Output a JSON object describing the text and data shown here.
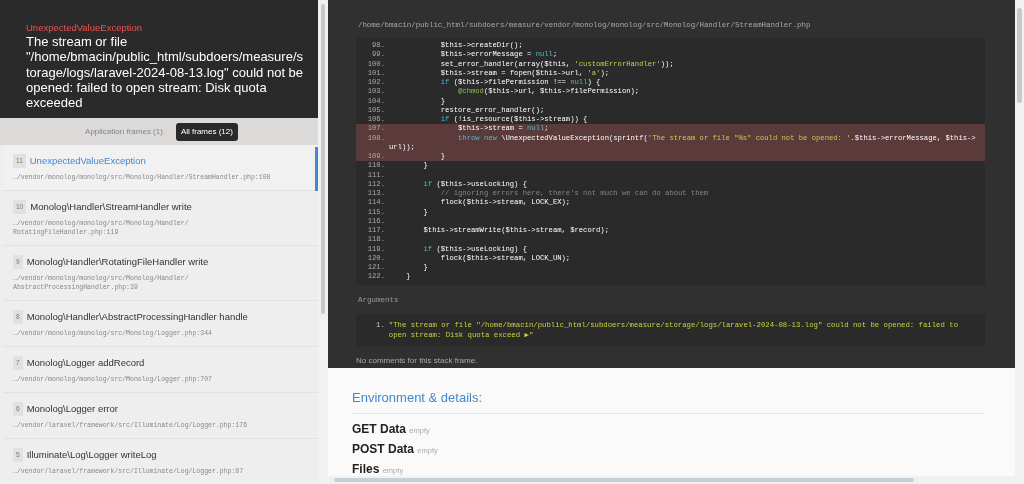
{
  "header": {
    "exception_class": "UnexpectedValueException",
    "message": "The stream or file \"/home/bmacin/public_html/subdoers/measure/storage/logs/laravel-2024-08-13.log\" could not be opened: failed to open stream: Disk quota exceeded"
  },
  "frame_tabs": [
    {
      "label": "Application frames (1)",
      "selected": false
    },
    {
      "label": "All frames (12)",
      "selected": true
    }
  ],
  "frames": [
    {
      "number": "11",
      "title": "UnexpectedValueException",
      "path": "…/vendor/monolog/monolog/src/Monolog/Handler/StreamHandler.php:108",
      "selected": true
    },
    {
      "number": "10",
      "title": "Monolog\\Handler\\StreamHandler write",
      "path": "…/vendor/monolog/monolog/src/Monolog/Handler/\nRotatingFileHandler.php:119",
      "selected": false
    },
    {
      "number": "9",
      "title": "Monolog\\Handler\\RotatingFileHandler write",
      "path": "…/vendor/monolog/monolog/src/Monolog/Handler/\nAbstractProcessingHandler.php:39",
      "selected": false
    },
    {
      "number": "8",
      "title": "Monolog\\Handler\\AbstractProcessingHandler handle",
      "path": "…/vendor/monolog/monolog/src/Monolog/Logger.php:344",
      "selected": false
    },
    {
      "number": "7",
      "title": "Monolog\\Logger addRecord",
      "path": "…/vendor/monolog/monolog/src/Monolog/Logger.php:707",
      "selected": false
    },
    {
      "number": "6",
      "title": "Monolog\\Logger error",
      "path": "…/vendor/laravel/framework/src/Illuminate/Log/Logger.php:176",
      "selected": false
    },
    {
      "number": "5",
      "title": "Illuminate\\Log\\Logger writeLog",
      "path": "…/vendor/laravel/framework/src/Illuminate/Log/Logger.php:87",
      "selected": false
    }
  ],
  "code": {
    "file_path": "/home/bmacin/public_html/subdoers/measure/vendor/monolog/monolog/src/Monolog/Handler/StreamHandler.php",
    "lines": [
      {
        "number": "98.",
        "highlighted": false,
        "tokens": [
          {
            "text": "            $this->createDir();",
            "kind": "plain"
          }
        ]
      },
      {
        "number": "99.",
        "highlighted": false,
        "tokens": [
          {
            "text": "            $this->errorMessage = ",
            "kind": "plain"
          },
          {
            "text": "null",
            "kind": "keyword"
          },
          {
            "text": ";",
            "kind": "plain"
          }
        ]
      },
      {
        "number": "100.",
        "highlighted": false,
        "tokens": [
          {
            "text": "            set_error_handler(array($this, ",
            "kind": "plain"
          },
          {
            "text": "'customErrorHandler'",
            "kind": "string"
          },
          {
            "text": "));",
            "kind": "plain"
          }
        ]
      },
      {
        "number": "101.",
        "highlighted": false,
        "tokens": [
          {
            "text": "            $this->stream = fopen($this->url, ",
            "kind": "plain"
          },
          {
            "text": "'a'",
            "kind": "string"
          },
          {
            "text": ");",
            "kind": "plain"
          }
        ]
      },
      {
        "number": "102.",
        "highlighted": false,
        "tokens": [
          {
            "text": "            if",
            "kind": "keyword"
          },
          {
            "text": " ($this->filePermission !== ",
            "kind": "plain"
          },
          {
            "text": "null",
            "kind": "keyword"
          },
          {
            "text": ") {",
            "kind": "plain"
          }
        ]
      },
      {
        "number": "103.",
        "highlighted": false,
        "tokens": [
          {
            "text": "                @chmod",
            "kind": "function"
          },
          {
            "text": "($this->url, $this->filePermission);",
            "kind": "plain"
          }
        ]
      },
      {
        "number": "104.",
        "highlighted": false,
        "tokens": [
          {
            "text": "            }",
            "kind": "plain"
          }
        ]
      },
      {
        "number": "105.",
        "highlighted": false,
        "tokens": [
          {
            "text": "            restore_error_handler();",
            "kind": "plain"
          }
        ]
      },
      {
        "number": "106.",
        "highlighted": false,
        "tokens": [
          {
            "text": "            if",
            "kind": "keyword"
          },
          {
            "text": " (!is_resource($this->stream)) {",
            "kind": "plain"
          }
        ]
      },
      {
        "number": "107.",
        "highlighted": true,
        "tokens": [
          {
            "text": "                $this->stream = ",
            "kind": "plain"
          },
          {
            "text": "null",
            "kind": "keyword"
          },
          {
            "text": ";",
            "kind": "plain"
          }
        ]
      },
      {
        "number": "108.",
        "highlighted": true,
        "tokens": [
          {
            "text": "                throw new",
            "kind": "keyword"
          },
          {
            "text": " \\UnexpectedValueException(sprintf(",
            "kind": "plain"
          },
          {
            "text": "'The stream or file \"%s\" could not be opened: '",
            "kind": "string"
          },
          {
            "text": ".$this->errorMessage, $this->url));",
            "kind": "plain"
          }
        ]
      },
      {
        "number": "109.",
        "highlighted": true,
        "tokens": [
          {
            "text": "            }",
            "kind": "plain"
          }
        ]
      },
      {
        "number": "110.",
        "highlighted": false,
        "tokens": [
          {
            "text": "        }",
            "kind": "plain"
          }
        ]
      },
      {
        "number": "111.",
        "highlighted": false
      },
      {
        "number": "112.",
        "highlighted": false,
        "tokens": [
          {
            "text": "        if",
            "kind": "keyword"
          },
          {
            "text": " ($this->useLocking) {",
            "kind": "plain"
          }
        ]
      },
      {
        "number": "113.",
        "highlighted": false,
        "tokens": [
          {
            "text": "            // ignoring errors here, there's not much we can do about them",
            "kind": "comment"
          }
        ]
      },
      {
        "number": "114.",
        "highlighted": false,
        "tokens": [
          {
            "text": "            flock($this->stream, LOCK_EX);",
            "kind": "plain"
          }
        ]
      },
      {
        "number": "115.",
        "highlighted": false,
        "tokens": [
          {
            "text": "        }",
            "kind": "plain"
          }
        ]
      },
      {
        "number": "116.",
        "highlighted": false
      },
      {
        "number": "117.",
        "highlighted": false,
        "tokens": [
          {
            "text": "        $this->streamWrite($this->stream, $record);",
            "kind": "plain"
          }
        ]
      },
      {
        "number": "118.",
        "highlighted": false
      },
      {
        "number": "119.",
        "highlighted": false,
        "tokens": [
          {
            "text": "        if",
            "kind": "keyword"
          },
          {
            "text": " ($this->useLocking) {",
            "kind": "plain"
          }
        ]
      },
      {
        "number": "120.",
        "highlighted": false,
        "tokens": [
          {
            "text": "            flock($this->stream, LOCK_UN);",
            "kind": "plain"
          }
        ]
      },
      {
        "number": "121.",
        "highlighted": false,
        "tokens": [
          {
            "text": "        }",
            "kind": "plain"
          }
        ]
      },
      {
        "number": "122.",
        "highlighted": false,
        "tokens": [
          {
            "text": "    }",
            "kind": "plain"
          }
        ]
      }
    ]
  },
  "arguments": {
    "title": "Arguments",
    "items": [
      {
        "number": "1.",
        "value": "\"The stream or file \"/home/bmacin/public_html/subdoers/measure/storage/logs/laravel-2024-08-13.log\" could not be opened: failed to open stream: Disk quota exceed ▶\""
      }
    ]
  },
  "comments": "No comments for this stack frame.",
  "environment": {
    "title": "Environment & details:",
    "sections": [
      {
        "name": "GET Data",
        "status": "empty"
      },
      {
        "name": "POST Data",
        "status": "empty"
      },
      {
        "name": "Files",
        "status": "empty"
      }
    ]
  }
}
